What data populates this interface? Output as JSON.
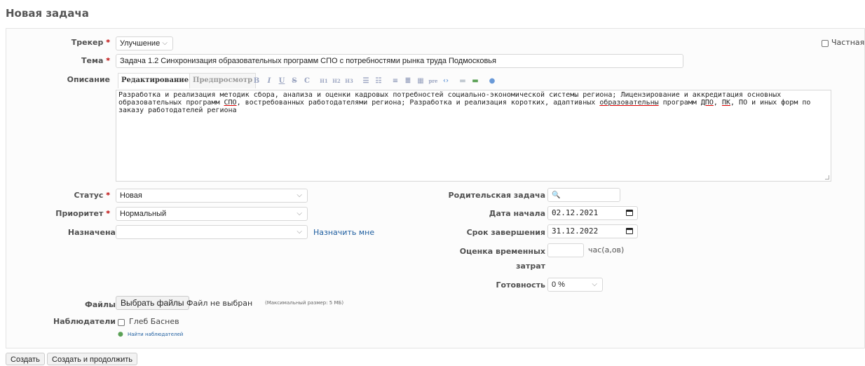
{
  "page": {
    "title": "Новая задача"
  },
  "form": {
    "tracker": {
      "label": "Трекер",
      "value": "Улучшение"
    },
    "private": {
      "label": "Частная",
      "checked": false
    },
    "subject": {
      "label": "Тема",
      "value": "Задача 1.2 Синхронизация образовательных программ СПО с потребностями рынка труда Подмосковья"
    },
    "description": {
      "label": "Описание",
      "tabs": {
        "edit": "Редактирование",
        "preview": "Предпросмотр"
      },
      "toolbar": [
        "B",
        "I",
        "U",
        "S",
        "C",
        "H1",
        "H2",
        "H3",
        "ul",
        "ol",
        "left",
        "right",
        "table",
        "pre",
        "code",
        "img",
        "link",
        "help"
      ],
      "text": {
        "line1": "Разработка и реализация методик сбора, анализа и оценки кадровых потребностей социально-экономической системы региона; Лицензирование и аккредитация основных",
        "line2a": "образовательных программ ",
        "line2b": "СПО",
        "line2c": ", востребованных работодателями региона; Разработка и реализация коротких, адаптивных ",
        "line2d": "образовательны",
        "line2e": " программ ",
        "line2f": "ДПО",
        "line2g": ", ",
        "line2h": "ПК",
        "line2i": ", ПО и иных форм по",
        "line3": "заказу работодателей региона"
      }
    },
    "status": {
      "label": "Статус",
      "value": "Новая"
    },
    "priority": {
      "label": "Приоритет",
      "value": "Нормальный"
    },
    "assignee": {
      "label": "Назначена",
      "value": "",
      "assign_me": "Назначить мне"
    },
    "parent": {
      "label": "Родительская задача",
      "value": ""
    },
    "start_date": {
      "label": "Дата начала",
      "value": "02.12.2021"
    },
    "due_date": {
      "label": "Срок завершения",
      "value": "31.12.2022"
    },
    "estimate": {
      "label_line1": "Оценка временных",
      "label_line2": "затрат",
      "value": "",
      "unit": "час(а,ов)"
    },
    "done": {
      "label": "Готовность",
      "value": "0 %"
    },
    "files": {
      "label": "Файлы",
      "choose": "Выбрать файлы",
      "none": "Файл не выбран",
      "max": "(Максимальный размер: 5 МБ)"
    },
    "watchers": {
      "label": "Наблюдатели",
      "user": "Глеб Баснев",
      "find": "Найти наблюдателей"
    }
  },
  "actions": {
    "create": "Создать",
    "create_continue": "Создать и продолжить"
  },
  "colors": {
    "required": "#bb0000",
    "link": "#1d5d9f",
    "box_bg": "#fcfcfc"
  }
}
